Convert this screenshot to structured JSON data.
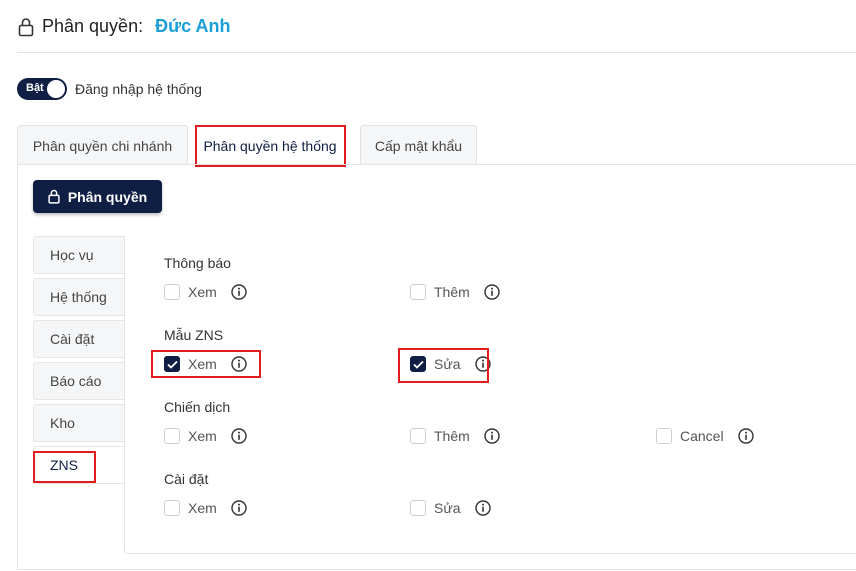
{
  "header": {
    "prefix": "Phân quyền:",
    "name": "Đức Anh"
  },
  "toggle": {
    "state": "Bật",
    "label": "Đăng nhập hệ thống"
  },
  "tabs": [
    "Phân quyền chi nhánh",
    "Phân quyền hệ thống",
    "Cấp mật khẩu"
  ],
  "active_tab": "Phân quyền hệ thống",
  "permission_button": "Phân quyền",
  "side_tabs": [
    "Học vụ",
    "Hệ thống",
    "Cài đặt",
    "Báo cáo",
    "Kho",
    "ZNS"
  ],
  "active_side_tab": "ZNS",
  "sections": [
    {
      "title": "Thông báo",
      "options": [
        {
          "label": "Xem",
          "checked": false
        },
        {
          "label": "Thêm",
          "checked": false
        }
      ]
    },
    {
      "title": "Mẫu ZNS",
      "options": [
        {
          "label": "Xem",
          "checked": true
        },
        {
          "label": "Sửa",
          "checked": true
        }
      ]
    },
    {
      "title": "Chiến dịch",
      "options": [
        {
          "label": "Xem",
          "checked": false
        },
        {
          "label": "Thêm",
          "checked": false
        },
        {
          "label": "Cancel",
          "checked": false
        }
      ]
    },
    {
      "title": "Cài đặt",
      "options": [
        {
          "label": "Xem",
          "checked": false
        },
        {
          "label": "Sửa",
          "checked": false
        }
      ]
    }
  ],
  "colors": {
    "primary": "#0f1f44",
    "accent": "#1a9fd6",
    "highlight": "#e21c1c"
  }
}
